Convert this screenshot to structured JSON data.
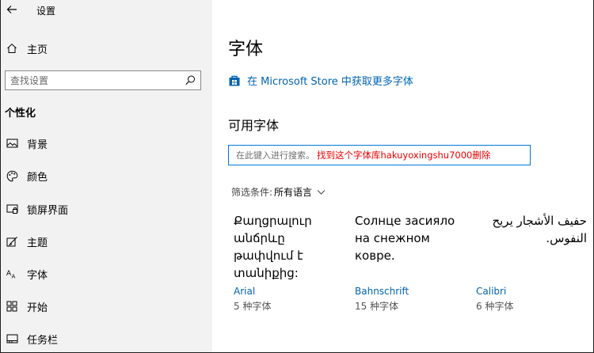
{
  "window": {
    "title": "设置"
  },
  "sidebar": {
    "home_label": "主页",
    "search_placeholder": "查找设置",
    "section_title": "个性化",
    "items": [
      {
        "label": "背景",
        "icon": "picture-icon"
      },
      {
        "label": "颜色",
        "icon": "palette-icon"
      },
      {
        "label": "锁屏界面",
        "icon": "lock-screen-icon"
      },
      {
        "label": "主题",
        "icon": "theme-brush-icon"
      },
      {
        "label": "字体",
        "icon": "font-aa-icon"
      },
      {
        "label": "开始",
        "icon": "start-grid-icon"
      },
      {
        "label": "任务栏",
        "icon": "taskbar-icon"
      }
    ]
  },
  "main": {
    "title": "字体",
    "store_link": "在 Microsoft Store 中获取更多字体",
    "available_heading": "可用字体",
    "font_search_placeholder": "在此键入进行搜索。",
    "font_search_note": "找到这个字体库hakuyoxingshu7000删除",
    "filter_label": "筛选条件:",
    "filter_value": "所有语言",
    "fonts": [
      {
        "sample": "Քաղցրալուր անճրևը թափվում է տանիքից:",
        "name": "Arial",
        "count": "5 种字体"
      },
      {
        "sample": "Солнце засияло на снежном ковре.",
        "name": "Bahnschrift",
        "count": "15 种字体"
      },
      {
        "sample": "حفيف الأشجار يريح النفوس.",
        "name": "Calibri",
        "count": "6 种字体"
      }
    ]
  },
  "colors": {
    "accent": "#0063b1",
    "sidebar_bg": "#f2f2f2",
    "annotation": "#e60000"
  }
}
